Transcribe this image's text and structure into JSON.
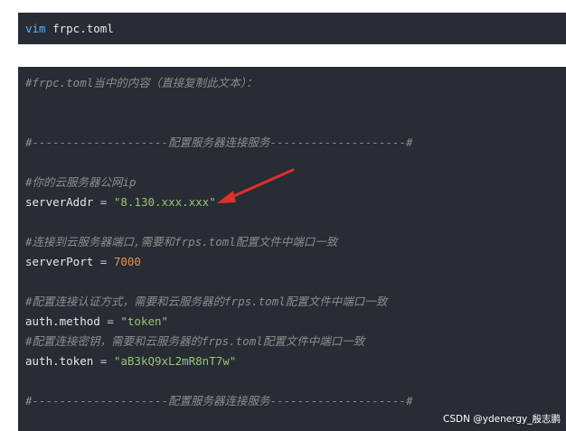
{
  "command_block": {
    "keyword": "vim",
    "argument": " frpc.toml"
  },
  "config_block": {
    "lines": {
      "title_comment": "#frpc.toml当中的内容（直接复制此文本）：",
      "section_start": "#--------------------配置服务器连接服务--------------------#",
      "ip_comment": "#你的云服务器公网ip",
      "server_addr": {
        "key": "serverAddr",
        "op": " = ",
        "value": "\"8.130.xxx.xxx\""
      },
      "port_comment": "#连接到云服务器端口,需要和frps.toml配置文件中端口一致",
      "server_port": {
        "key": "serverPort",
        "op": " = ",
        "value": "7000"
      },
      "auth_comment": "#配置连接认证方式，需要和云服务器的frps.toml配置文件中端口一致",
      "auth_method": {
        "key": "auth.method",
        "op": " = ",
        "value": "\"token\""
      },
      "token_comment": "#配置连接密钥，需要和云服务器的frps.toml配置文件中端口一致",
      "auth_token": {
        "key": "auth.token",
        "op": " = ",
        "value": "\"aB3kQ9xL2mR8nT7w\""
      },
      "section_end": "#--------------------配置服务器连接服务--------------------#"
    },
    "watermark": "CSDN @ydenergy_殷志鹏"
  },
  "annotation": {
    "arrow_color": "#e0302a"
  }
}
